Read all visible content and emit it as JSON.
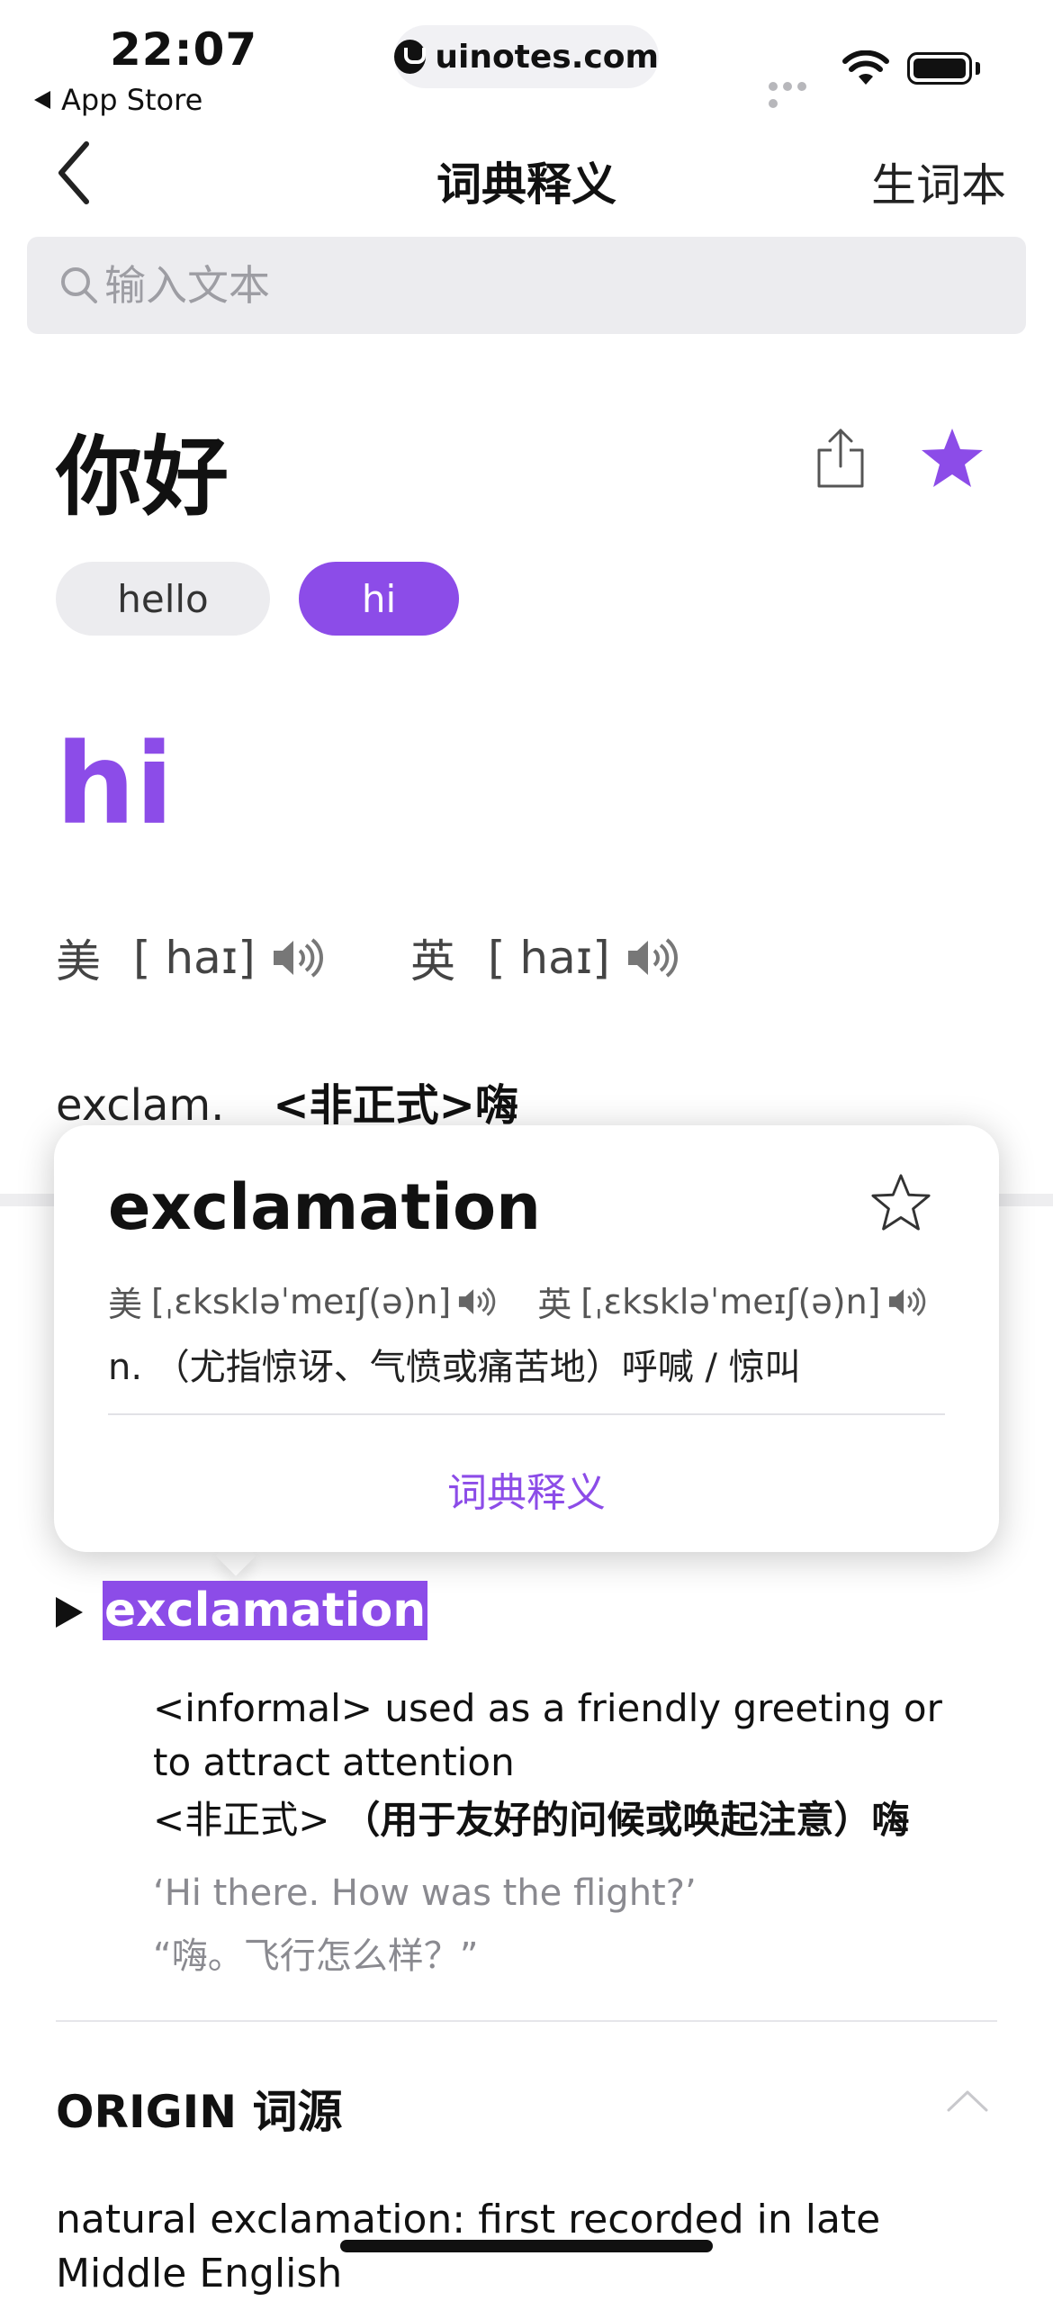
{
  "status_bar": {
    "time": "22:07",
    "back_app": "App Store",
    "url": "uinotes.com"
  },
  "nav": {
    "title": "词典释义",
    "right_label": "生词本"
  },
  "search": {
    "placeholder": "输入文本"
  },
  "query": {
    "text": "你好",
    "favorited": true
  },
  "chips": [
    {
      "label": "hello",
      "selected": false
    },
    {
      "label": "hi",
      "selected": true
    }
  ],
  "entry": {
    "headword": "hi",
    "us_label": "美",
    "us_ipa": "[ haɪ]",
    "uk_label": "英",
    "uk_ipa": "[ haɪ]",
    "pos": "exclam.",
    "pos_gloss": "<非正式>嗨"
  },
  "popup": {
    "word": "exclamation",
    "us_label": "美",
    "us_ipa": "[ˌɛkskləˈmeɪʃ(ə)n]",
    "uk_label": "英",
    "uk_ipa": "[ˌɛkskləˈmeɪʃ(ə)n]",
    "definition": "n. （尤指惊讶、气愤或痛苦地）呼喊 / 惊叫",
    "link": "词典释义"
  },
  "sense": {
    "label": "exclamation",
    "def_en": "<informal> used as a friendly greeting or to attract attention",
    "def_zh_prefix": "<非正式>",
    "def_zh_bold": "（用于友好的问候或唤起注意）嗨",
    "example_en": "‘Hi there. How was the flight?’",
    "example_zh": "“嗨。飞行怎么样？”"
  },
  "origin": {
    "title": "ORIGIN 词源",
    "text": "natural exclamation: first recorded in late Middle English"
  },
  "colors": {
    "accent": "#8c4ce8",
    "chip_bg": "#ececef",
    "search_bg": "#ececef"
  }
}
